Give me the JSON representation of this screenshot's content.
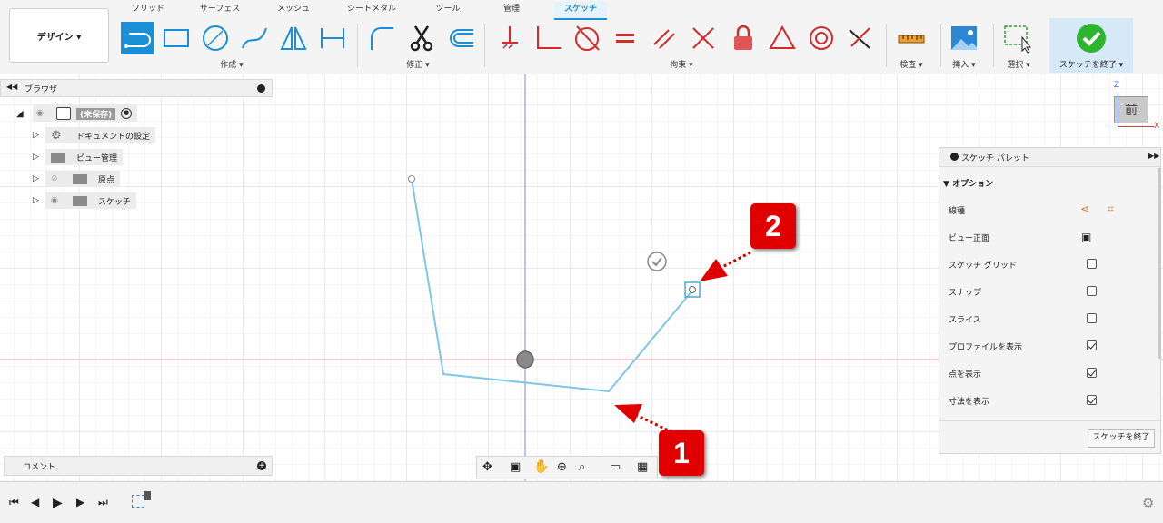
{
  "toolbar": {
    "design_label": "デザイン ▾",
    "tabs": [
      "ソリッド",
      "サーフェス",
      "メッシュ",
      "シートメタル",
      "ツール",
      "管理",
      "スケッチ"
    ],
    "active_tab": "スケッチ",
    "groups": {
      "create": "作成 ▾",
      "modify": "修正 ▾",
      "constraints": "拘束 ▾",
      "inspect": "検査 ▾",
      "insert": "挿入 ▾",
      "select": "選択 ▾",
      "finish": "スケッチを終了 ▾"
    },
    "accent_color": "#1a8fd6",
    "constraint_color": "#d42a2a",
    "finish_color": "#2db52d"
  },
  "browser": {
    "title": "ブラウザ",
    "items": [
      {
        "label": "(未保存)",
        "icon": "document-icon"
      },
      {
        "label": "ドキュメントの設定",
        "icon": "gear-icon"
      },
      {
        "label": "ビュー管理",
        "icon": "folder-icon"
      },
      {
        "label": "原点",
        "icon": "folder-icon"
      },
      {
        "label": "スケッチ",
        "icon": "folder-icon"
      }
    ]
  },
  "comment": {
    "label": "コメント"
  },
  "viewcube": {
    "face": "前",
    "axis_z": "Z",
    "axis_x": "X"
  },
  "palette": {
    "title": "スケッチ パレット",
    "section": "オプション",
    "rows": [
      {
        "label": "線種",
        "type": "icons"
      },
      {
        "label": "ビュー正面",
        "type": "icon"
      },
      {
        "label": "スケッチ グリッド",
        "type": "checkbox",
        "checked": false
      },
      {
        "label": "スナップ",
        "type": "checkbox",
        "checked": false
      },
      {
        "label": "スライス",
        "type": "checkbox",
        "checked": false
      },
      {
        "label": "プロファイルを表示",
        "type": "checkbox",
        "checked": true
      },
      {
        "label": "点を表示",
        "type": "checkbox",
        "checked": true
      },
      {
        "label": "寸法を表示",
        "type": "checkbox",
        "checked": true
      }
    ],
    "finish_button": "スケッチを終了"
  },
  "callouts": {
    "one": "1",
    "two": "2"
  }
}
